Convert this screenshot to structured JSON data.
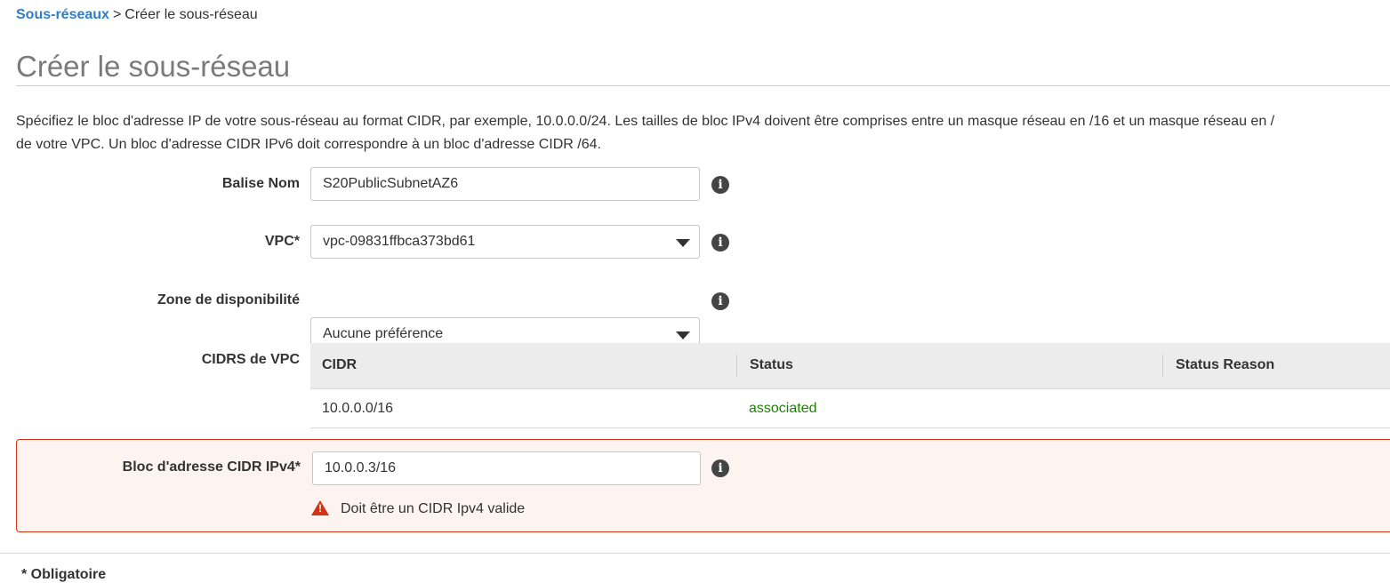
{
  "breadcrumb": {
    "parent": "Sous-réseaux",
    "separator": ">",
    "current": "Créer le sous-réseau"
  },
  "page_title": "Créer le sous-réseau",
  "description": {
    "line1": "Spécifiez le bloc d'adresse IP de votre sous-réseau au format CIDR, par exemple, 10.0.0.0/24. Les tailles de bloc IPv4 doivent être comprises entre un masque réseau en /16 et un masque réseau en /",
    "line2": "de votre VPC. Un bloc d'adresse CIDR IPv6 doit correspondre à un bloc d'adresse CIDR /64."
  },
  "form": {
    "name_tag": {
      "label": "Balise Nom",
      "value": "S20PublicSubnetAZ6"
    },
    "vpc": {
      "label": "VPC*",
      "value": "vpc-09831ffbca373bd61"
    },
    "availability_zone": {
      "label": "Zone de disponibilité",
      "value": "Aucune préférence"
    },
    "vpc_cidrs": {
      "label": "CIDRS de VPC",
      "columns": [
        "CIDR",
        "Status",
        "Status Reason"
      ],
      "rows": [
        {
          "cidr": "10.0.0.0/16",
          "status": "associated",
          "status_reason": ""
        }
      ]
    },
    "ipv4_cidr": {
      "label": "Bloc d'adresse CIDR IPv4*",
      "value": "10.0.0.3/16",
      "error": "Doit être un CIDR Ipv4 valide"
    }
  },
  "footer": {
    "required_note": "* Obligatoire"
  },
  "colors": {
    "link": "#2f7ec9",
    "status_associated": "#1d8102",
    "error_border": "#d13212",
    "error_background": "#fdf3f1"
  },
  "icons": [
    "info-icon",
    "chevron-down-icon",
    "warning-icon"
  ]
}
